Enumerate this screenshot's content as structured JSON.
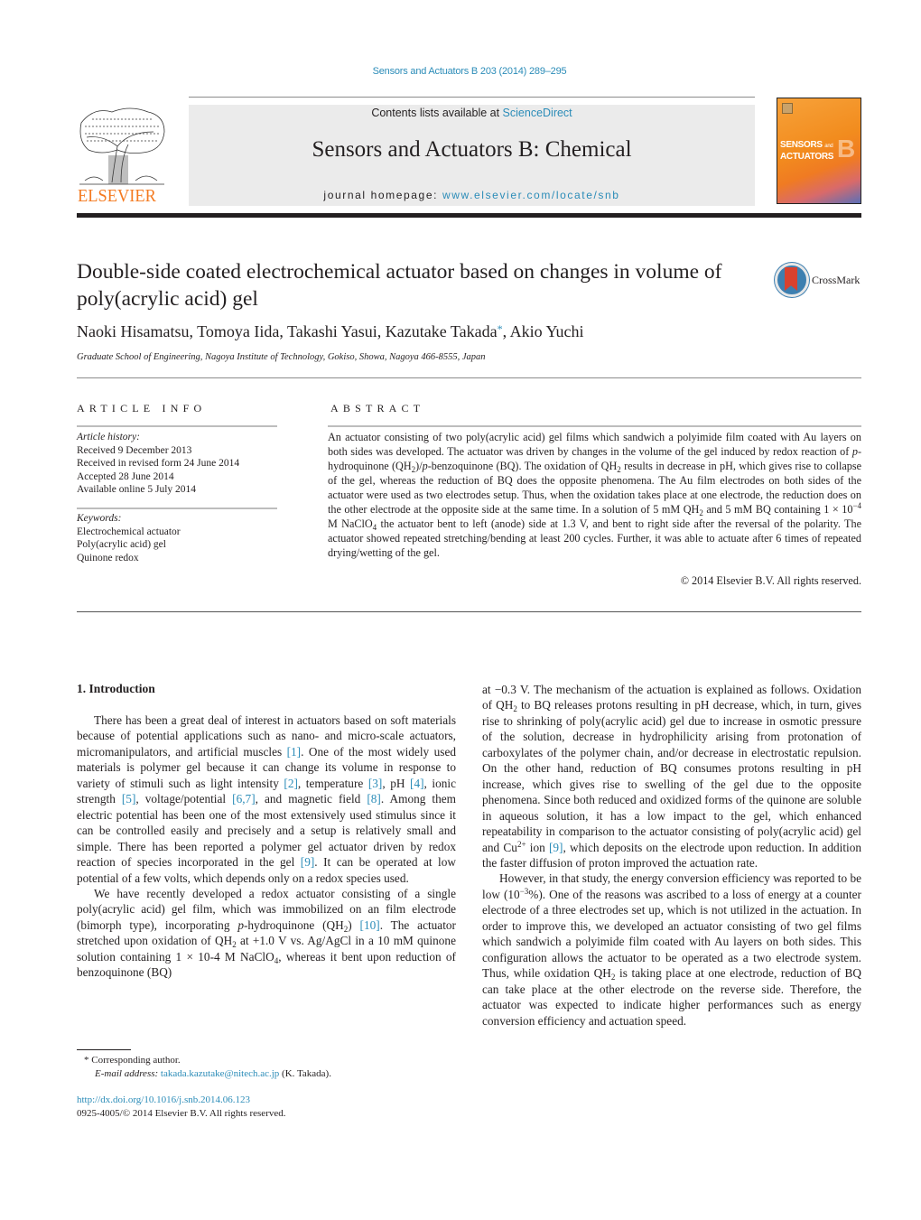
{
  "header": {
    "citation": "Sensors and Actuators B 203 (2014) 289–295",
    "publisher_logo": "ELSEVIER",
    "contents_prefix": "Contents lists available at ",
    "contents_link": "ScienceDirect",
    "journal_title": "Sensors and Actuators B: Chemical",
    "homepage_prefix": "journal homepage: ",
    "homepage_link": "www.elsevier.com/locate/snb",
    "cover_line1": "SENSORS",
    "cover_and": "and",
    "cover_line2": "ACTUATORS",
    "cover_letter": "B",
    "colors": {
      "link": "#2b8cb8",
      "elsevier_orange": "#f47a20",
      "masthead_bg": "#ebebeb"
    }
  },
  "article": {
    "title": "Double-side coated electrochemical actuator based on changes in volume of poly(acrylic acid) gel",
    "crossmark_label": "CrossMark",
    "authors_before_star": "Naoki Hisamatsu, Tomoya Iida, Takashi Yasui, Kazutake Takada",
    "corresponding_mark": "*",
    "authors_after_star": ", Akio Yuchi",
    "affiliation": "Graduate School of Engineering, Nagoya Institute of Technology, Gokiso, Showa, Nagoya 466-8555, Japan"
  },
  "article_info": {
    "heading": "ARTICLE INFO",
    "history_label": "Article history:",
    "history": [
      "Received 9 December 2013",
      "Received in revised form 24 June 2014",
      "Accepted 28 June 2014",
      "Available online 5 July 2014"
    ],
    "keywords_label": "Keywords:",
    "keywords": [
      "Electrochemical actuator",
      "Poly(acrylic acid) gel",
      "Quinone redox"
    ]
  },
  "abstract": {
    "heading": "ABSTRACT",
    "s1": "An actuator consisting of two poly(acrylic acid) gel films which sandwich a polyimide film coated with Au layers on both sides was developed. The actuator was driven by changes in the volume of the gel induced by redox reaction of ",
    "p1": "p",
    "s2": "-hydroquinone (QH",
    "sub2": "2",
    "s3": ")/",
    "p2": "p",
    "s4": "-benzoquinone (BQ). The oxidation of QH",
    "sub2b": "2",
    "s5": " results in decrease in pH, which gives rise to collapse of the gel, whereas the reduction of BQ does the opposite phenomena. The Au film electrodes on both sides of the actuator were used as two electrodes setup. Thus, when the oxidation takes place at one electrode, the reduction does on the other electrode at the opposite side at the same time. In a solution of 5 mM QH",
    "sub2c": "2",
    "s6": " and 5 mM BQ containing 1 × 10",
    "sup_exp": "−4",
    "s7": " M NaClO",
    "sub4": "4",
    "s8": " the actuator bent to left (anode) side at 1.3 V, and bent to right side after the reversal of the polarity. The actuator showed repeated stretching/bending at least 200 cycles. Further, it was able to actuate after 6 times of repeated drying/wetting of the gel.",
    "copyright": "© 2014 Elsevier B.V. All rights reserved."
  },
  "body": {
    "section_heading": "1.  Introduction",
    "left": {
      "p1_a": "There has been a great deal of interest in actuators based on soft materials because of potential applications such as nano- and micro-scale actuators, micromanipulators, and artificial muscles ",
      "ref1": "[1]",
      "p1_b": ". One of the most widely used materials is polymer gel because it can change its volume in response to variety of stimuli such as light intensity ",
      "ref2": "[2]",
      "p1_c": ", temperature ",
      "ref3": "[3]",
      "p1_d": ", pH ",
      "ref4": "[4]",
      "p1_e": ", ionic strength ",
      "ref5": "[5]",
      "p1_f": ", voltage/potential ",
      "ref67": "[6,7]",
      "p1_g": ", and magnetic field ",
      "ref8": "[8]",
      "p1_h": ". Among them electric potential has been one of the most extensively used stimulus since it can be controlled easily and precisely and a setup is relatively small and simple. There has been reported a polymer gel actuator driven by redox reaction of species incorporated in the gel ",
      "ref9": "[9]",
      "p1_i": ". It can be operated at low potential of a few volts, which depends only on a redox species used.",
      "p2_a": "We have recently developed a redox actuator consisting of a single poly(acrylic acid) gel film, which was immobilized on an film electrode (bimorph type), incorporating ",
      "p2_p": "p",
      "p2_b": "-hydroquinone (QH",
      "p2_sub": "2",
      "p2_c": ") ",
      "ref10": "[10]",
      "p2_d": ". The actuator stretched upon oxidation of QH",
      "p2_sub2": "2",
      "p2_e": " at +1.0 V vs. Ag/AgCl in a 10 mM quinone solution containing 1 × 10-4 M NaClO",
      "p2_sub4": "4",
      "p2_f": ", whereas it bent upon reduction of benzoquinone (BQ)"
    },
    "right": {
      "p1_a": "at −0.3 V. The mechanism of the actuation is explained as follows. Oxidation of QH",
      "p1_sub": "2",
      "p1_b": " to BQ releases protons resulting in pH decrease, which, in turn, gives rise to shrinking of poly(acrylic acid) gel due to increase in osmotic pressure of the solution, decrease in hydrophilicity arising from protonation of carboxylates of the polymer chain, and/or decrease in electrostatic repulsion. On the other hand, reduction of BQ consumes protons resulting in pH increase, which gives rise to swelling of the gel due to the opposite phenomena. Since both reduced and oxidized forms of the quinone are soluble in aqueous solution, it has a low impact to the gel, which enhanced repeatability in comparison to the actuator consisting of poly(acrylic acid) gel and Cu",
      "p1_sup": "2+",
      "p1_c": " ion ",
      "ref9": "[9]",
      "p1_d": ", which deposits on the electrode upon reduction. In addition the faster diffusion of proton improved the actuation rate.",
      "p2_a": "However, in that study, the energy conversion efficiency was reported to be low (10",
      "p2_sup": "−3",
      "p2_b": "%). One of the reasons was ascribed to a loss of energy at a counter electrode of a three electrodes set up, which is not utilized in the actuation. In order to improve this, we developed an actuator consisting of two gel films which sandwich a polyimide film coated with Au layers on both sides. This configuration allows the actuator to be operated as a two electrode system. Thus, while oxidation QH",
      "p2_sub": "2",
      "p2_c": " is taking place at one electrode, reduction of BQ can take place at the other electrode on the reverse side. Therefore, the actuator was expected to indicate higher performances such as energy conversion efficiency and actuation speed."
    }
  },
  "footnotes": {
    "star_label": "*  Corresponding author.",
    "email_label": "E-mail address: ",
    "email": "takada.kazutake@nitech.ac.jp",
    "email_owner": " (K. Takada).",
    "doi": "http://dx.doi.org/10.1016/j.snb.2014.06.123",
    "issn_copyright": "0925-4005/© 2014 Elsevier B.V. All rights reserved."
  }
}
